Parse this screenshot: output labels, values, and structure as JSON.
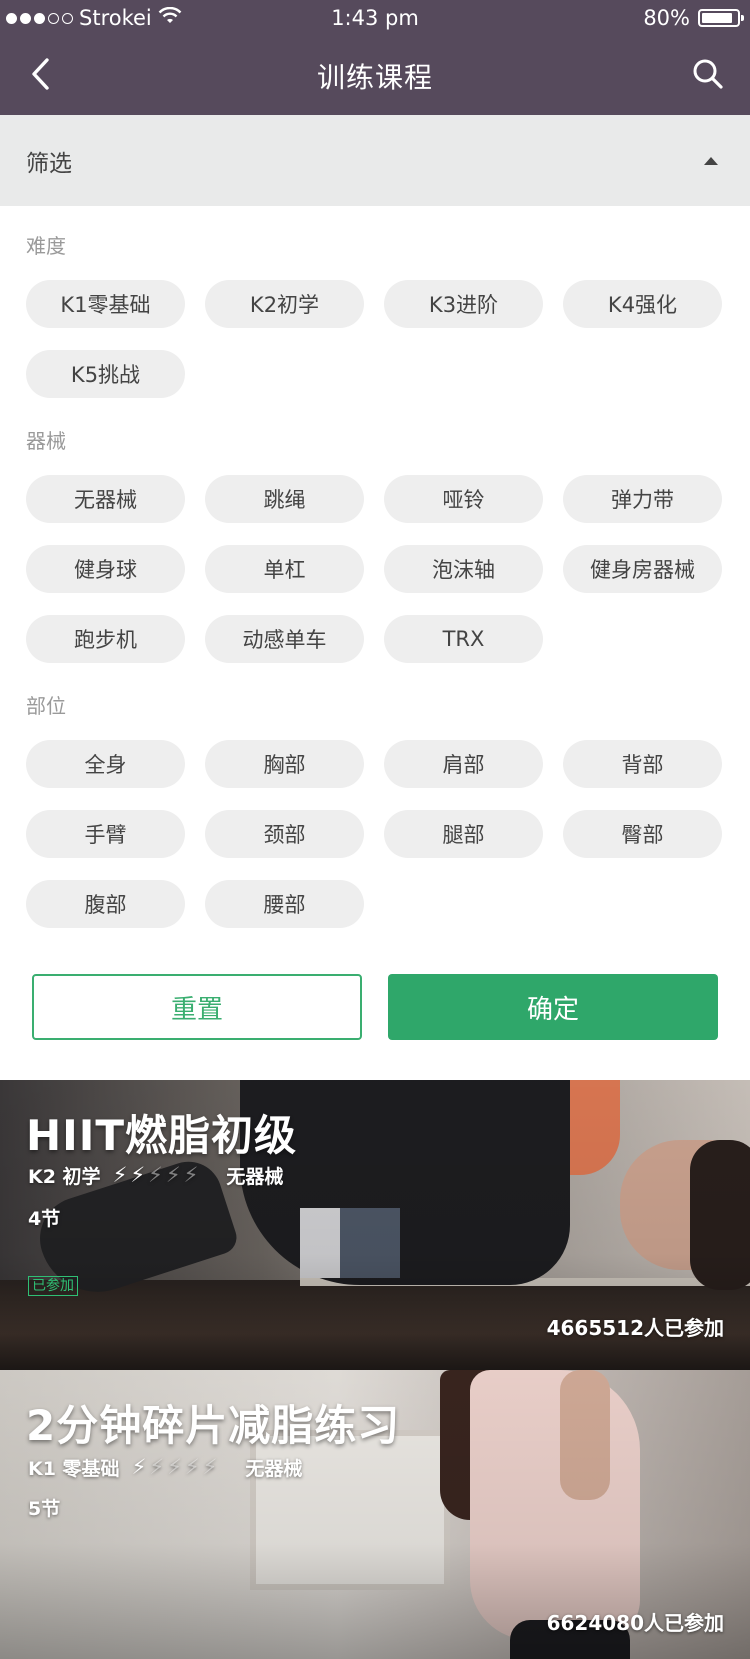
{
  "status_bar": {
    "carrier": "Strokei",
    "time": "1:43 pm",
    "battery": "80%",
    "signal_dots_filled": 3,
    "signal_dots_total": 5
  },
  "nav": {
    "title": "训练课程",
    "back_icon": "chevron-left-icon",
    "search_icon": "search-icon"
  },
  "filter": {
    "label": "筛选",
    "toggle_icon": "caret-up-icon",
    "sections": [
      {
        "title": "难度",
        "options": [
          "K1零基础",
          "K2初学",
          "K3进阶",
          "K4强化",
          "K5挑战"
        ]
      },
      {
        "title": "器械",
        "options": [
          "无器械",
          "跳绳",
          "哑铃",
          "弹力带",
          "健身球",
          "单杠",
          "泡沫轴",
          "健身房器械",
          "跑步机",
          "动感单车",
          "TRX"
        ]
      },
      {
        "title": "部位",
        "options": [
          "全身",
          "胸部",
          "肩部",
          "背部",
          "手臂",
          "颈部",
          "腿部",
          "臀部",
          "腹部",
          "腰部"
        ]
      }
    ],
    "reset_label": "重置",
    "confirm_label": "确定"
  },
  "courses": [
    {
      "title": "HIIT燃脂初级",
      "level": "K2 初学",
      "intensity": 2,
      "intensity_max": 5,
      "equipment": "无器械",
      "lessons": "4节",
      "joined_badge": "已参加",
      "participants": "4665512人已参加"
    },
    {
      "title": "2分钟碎片减脂练习",
      "level": "K1 零基础",
      "intensity": 1,
      "intensity_max": 5,
      "equipment": "无器械",
      "lessons": "5节",
      "participants": "6624080人已参加"
    }
  ],
  "colors": {
    "nav_bg": "#564a5c",
    "accent_green": "#2fa76a",
    "chip_bg": "#eeeeee",
    "filter_header_bg": "#e9eaea"
  }
}
